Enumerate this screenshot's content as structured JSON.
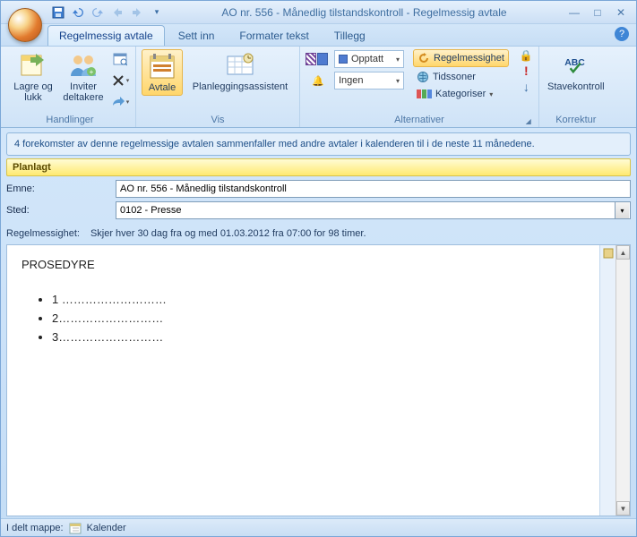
{
  "window": {
    "title": "AO nr. 556 - Månedlig tilstandskontroll - Regelmessig avtale"
  },
  "qat": {
    "save": "save-icon",
    "undo": "undo-icon",
    "redo": "redo-icon",
    "prev": "prev-icon",
    "next": "next-icon"
  },
  "tabs": {
    "t0": "Regelmessig avtale",
    "t1": "Sett inn",
    "t2": "Formater tekst",
    "t3": "Tillegg"
  },
  "ribbon": {
    "actions": {
      "save_close": "Lagre og lukk",
      "invite": "Inviter deltakere",
      "group": "Handlinger"
    },
    "view": {
      "appointment": "Avtale",
      "scheduling": "Planleggingsassistent",
      "group": "Vis"
    },
    "options": {
      "show_as": "Opptatt",
      "reminder_options": "Ingen",
      "recurrence": "Regelmessighet",
      "timezones": "Tidssoner",
      "categorize": "Kategoriser",
      "group": "Alternativer"
    },
    "proof": {
      "spellcheck": "Stavekontroll",
      "group": "Korrektur"
    }
  },
  "infobar": "4 forekomster av denne regelmessige avtalen sammenfaller med andre avtaler i kalenderen til  i de neste 11 månedene.",
  "status": "Planlagt",
  "form": {
    "subject_label": "Emne:",
    "subject_value": "AO nr. 556 - Månedlig tilstandskontroll",
    "location_label": "Sted:",
    "location_value": "0102 - Presse",
    "recur_label": "Regelmessighet:",
    "recur_value": "Skjer hver 30 dag fra og med 01.03.2012 fra 07:00 for 98 timer."
  },
  "body": {
    "heading": "PROSEDYRE",
    "items": [
      "1 ………………………",
      "2………………………",
      "3………………………"
    ]
  },
  "footer": {
    "label": "I delt mappe:",
    "folder": "Kalender"
  }
}
